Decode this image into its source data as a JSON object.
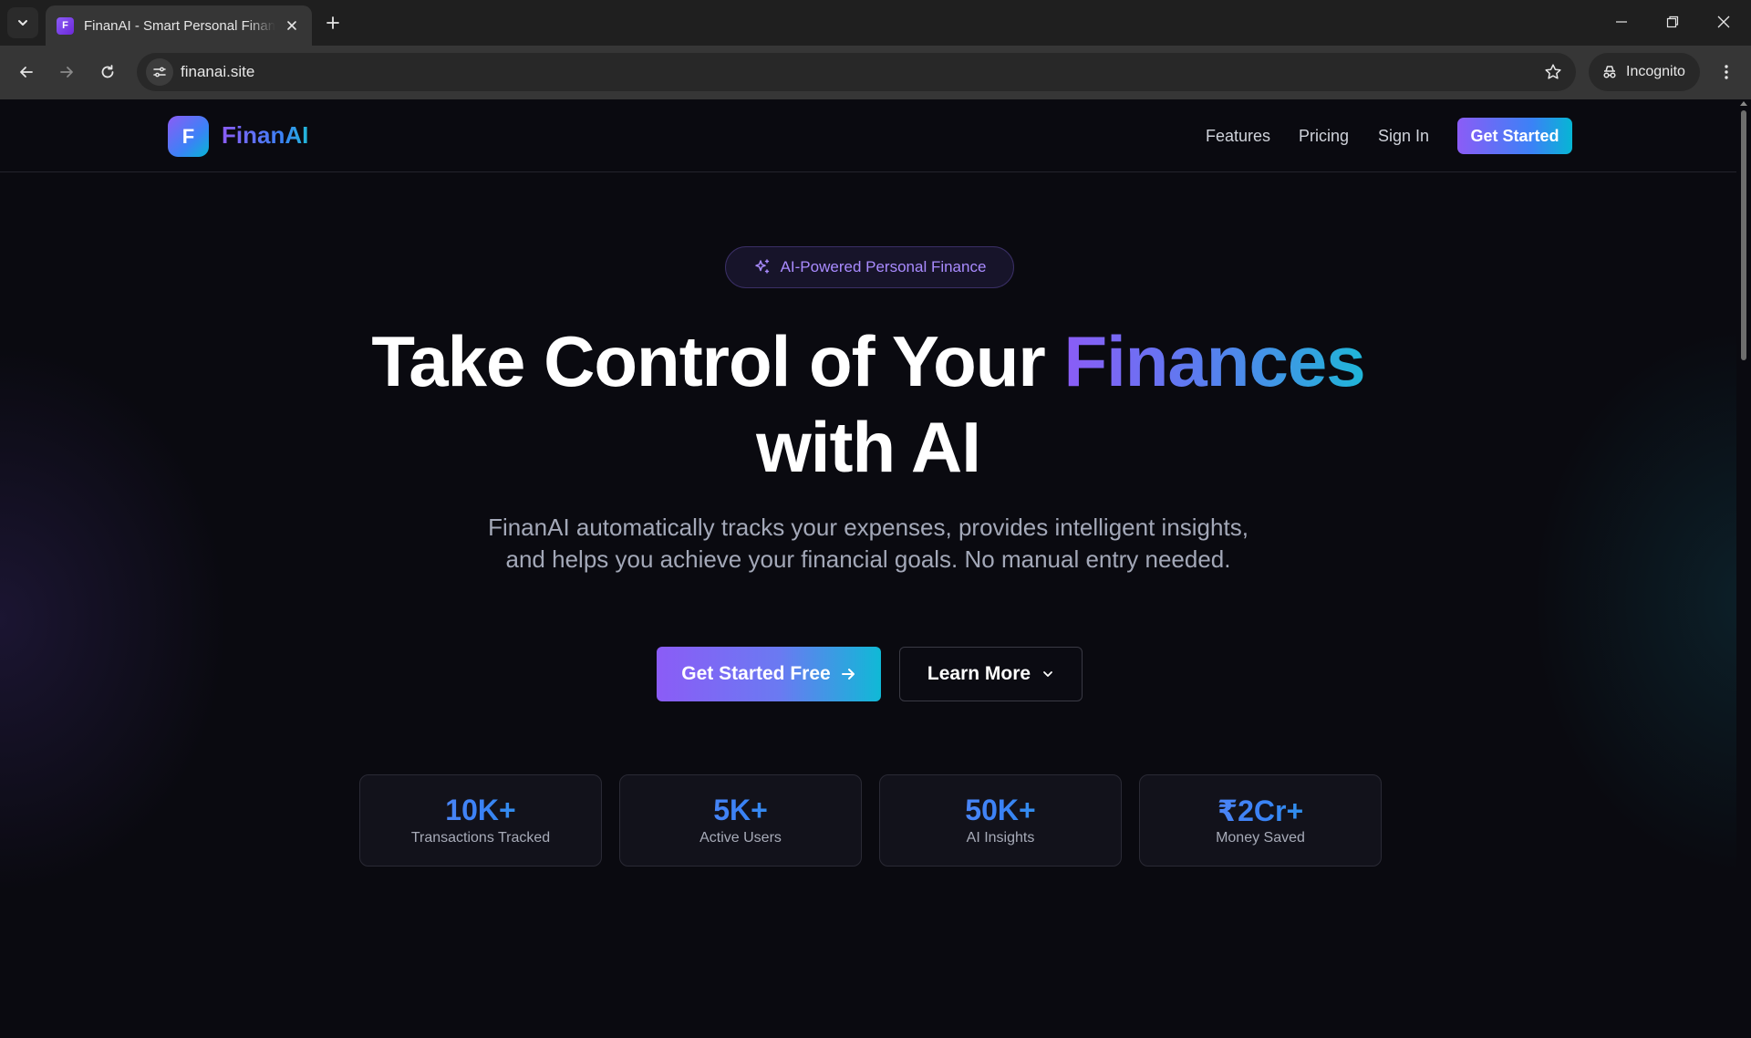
{
  "browser": {
    "tab_title": "FinanAI - Smart Personal Finance",
    "tab_favicon_letter": "F",
    "url": "finanai.site",
    "incognito_label": "Incognito"
  },
  "site": {
    "logo_letter": "F",
    "brand": "FinanAI",
    "nav": {
      "features": "Features",
      "pricing": "Pricing",
      "sign_in": "Sign In",
      "cta": "Get Started"
    }
  },
  "hero": {
    "badge": "AI-Powered Personal Finance",
    "headline_part1": "Take Control of Your ",
    "headline_highlight": "Finances",
    "headline_line2": "with AI",
    "subtext": "FinanAI automatically tracks your expenses, provides intelligent insights, and helps you achieve your financial goals. No manual entry needed.",
    "primary_button": "Get Started Free",
    "secondary_button": "Learn More"
  },
  "stats": [
    {
      "value": "10K+",
      "label": "Transactions Tracked"
    },
    {
      "value": "5K+",
      "label": "Active Users"
    },
    {
      "value": "50K+",
      "label": "AI Insights"
    },
    {
      "value": "₹2Cr+",
      "label": "Money Saved"
    }
  ],
  "colors": {
    "accent_purple": "#8b5cf6",
    "accent_blue": "#3b82f6",
    "accent_cyan": "#06b6d4",
    "background": "#0a0a10"
  }
}
